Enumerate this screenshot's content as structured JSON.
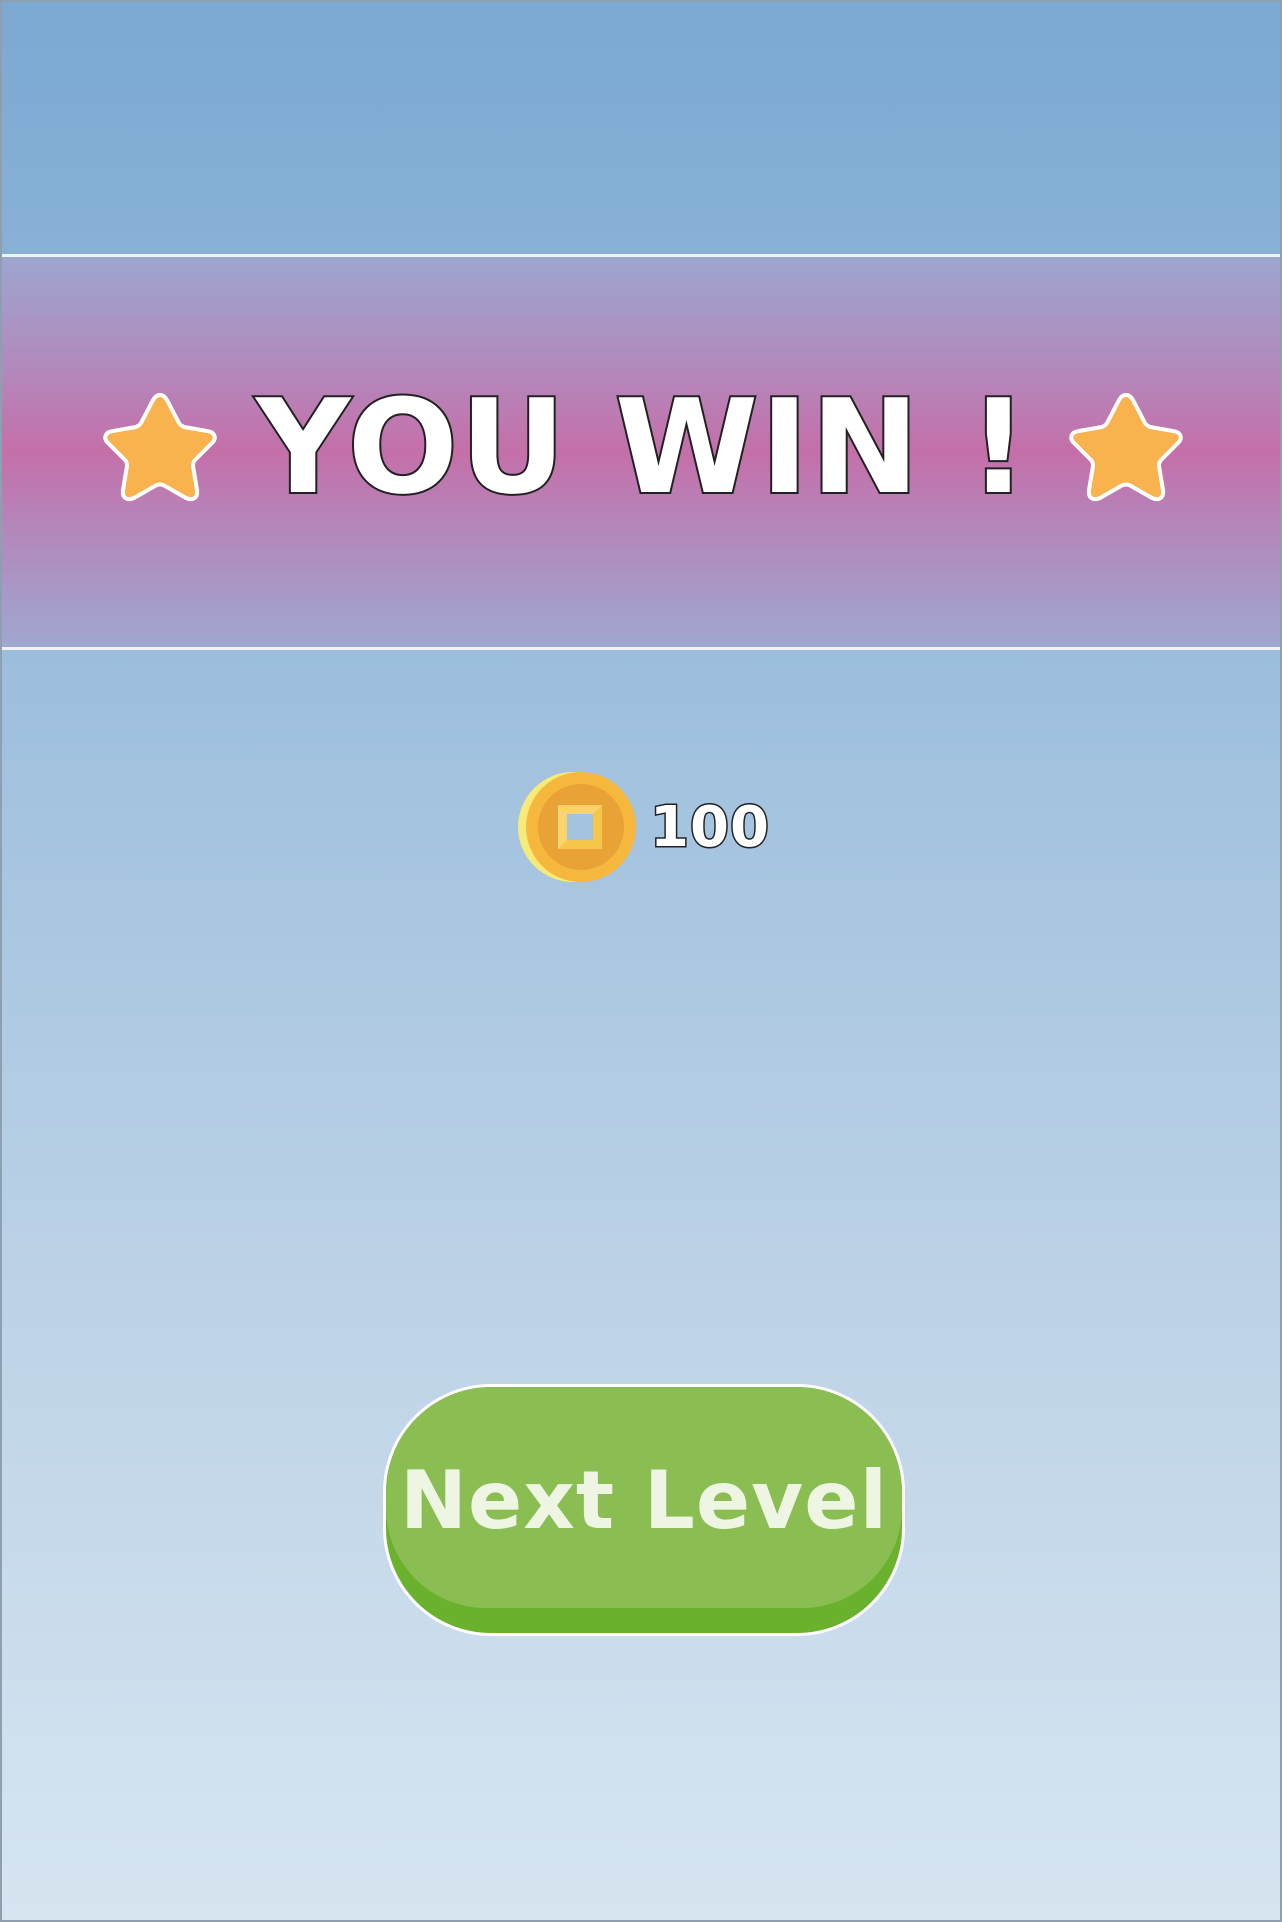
{
  "screen": {
    "name": "level-complete"
  },
  "banner": {
    "title": "YOU WIN !",
    "left_icon": "star-icon",
    "right_icon": "star-icon"
  },
  "reward": {
    "icon": "coin-icon",
    "amount": "100"
  },
  "next_button": {
    "label": "Next Level"
  },
  "colors": {
    "background_top": "#7ba9d2",
    "background_bottom": "#d7e5f1",
    "banner_center": "#c56fa9",
    "star": "#f8b24e",
    "coin": "#f5b83c",
    "button_face": "#8abd52",
    "button_shadow": "#6ab22e",
    "button_text": "#eef5e2"
  }
}
